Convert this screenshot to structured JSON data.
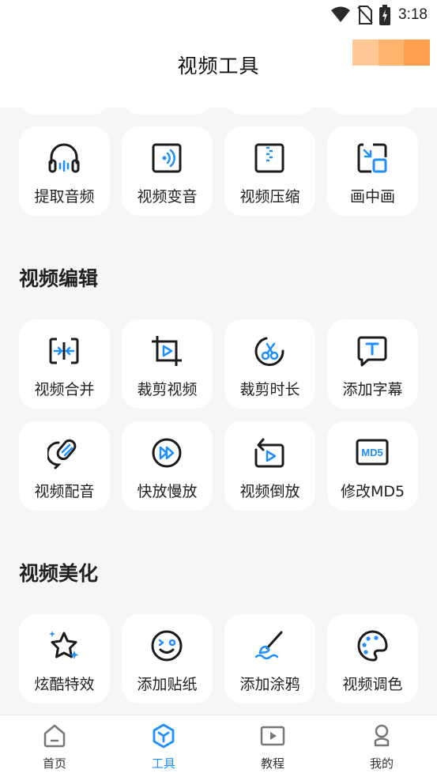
{
  "status_bar": {
    "time": "3:18"
  },
  "header": {
    "title": "视频工具",
    "badge_colors": [
      "#ffc896",
      "#ffb46e",
      "#ffa050"
    ]
  },
  "colors": {
    "accent": "#1e8fff",
    "icon_stroke": "#1b1b1b",
    "background": "#f6f6f8"
  },
  "top_row": [
    {
      "label": "提取音频",
      "icon": "headphones-icon"
    },
    {
      "label": "视频变音",
      "icon": "voice-change-icon"
    },
    {
      "label": "视频压缩",
      "icon": "zip-compress-icon"
    },
    {
      "label": "画中画",
      "icon": "picture-in-picture-icon"
    }
  ],
  "sections": [
    {
      "title": "视频编辑",
      "items": [
        {
          "label": "视频合并",
          "icon": "merge-icon"
        },
        {
          "label": "裁剪视频",
          "icon": "crop-video-icon"
        },
        {
          "label": "裁剪时长",
          "icon": "trim-duration-icon"
        },
        {
          "label": "添加字幕",
          "icon": "subtitle-icon"
        },
        {
          "label": "视频配音",
          "icon": "microphone-icon"
        },
        {
          "label": "快放慢放",
          "icon": "fast-forward-icon"
        },
        {
          "label": "视频倒放",
          "icon": "reverse-play-icon"
        },
        {
          "label": "修改MD5",
          "icon": "md5-icon"
        }
      ]
    },
    {
      "title": "视频美化",
      "items": [
        {
          "label": "炫酷特效",
          "icon": "sparkle-star-icon"
        },
        {
          "label": "添加贴纸",
          "icon": "sticker-face-icon"
        },
        {
          "label": "添加涂鸦",
          "icon": "paintbrush-icon"
        },
        {
          "label": "视频调色",
          "icon": "palette-icon"
        }
      ]
    }
  ],
  "tabbar": [
    {
      "label": "首页",
      "icon": "home-icon",
      "active": false
    },
    {
      "label": "工具",
      "icon": "tools-cube-icon",
      "active": true
    },
    {
      "label": "教程",
      "icon": "tutorial-play-icon",
      "active": false
    },
    {
      "label": "我的",
      "icon": "profile-icon",
      "active": false
    }
  ]
}
